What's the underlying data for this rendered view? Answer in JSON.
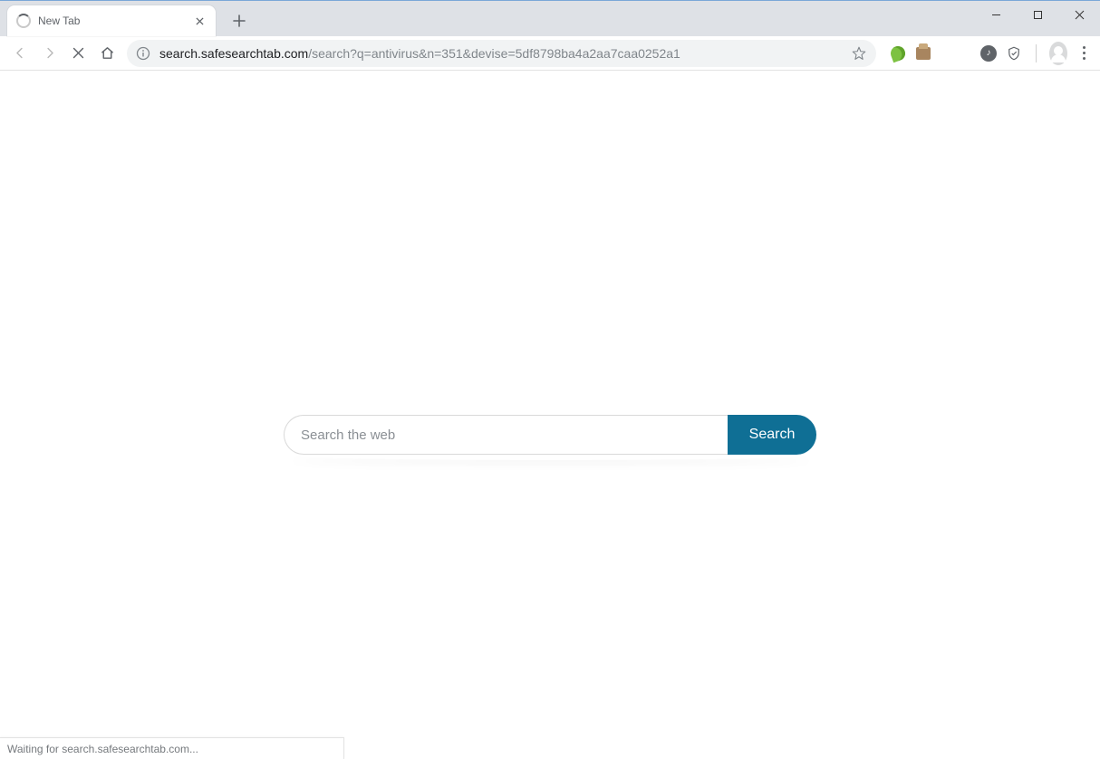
{
  "tab": {
    "title": "New Tab"
  },
  "url": {
    "host": "search.safesearchtab.com",
    "path": "/search?q=antivirus&n=351&devise=5df8798ba4a2aa7caa0252a1"
  },
  "search": {
    "placeholder": "Search the web",
    "value": "",
    "button_label": "Search"
  },
  "status": {
    "text": "Waiting for search.safesearchtab.com..."
  },
  "colors": {
    "search_button": "#0f6f95"
  }
}
